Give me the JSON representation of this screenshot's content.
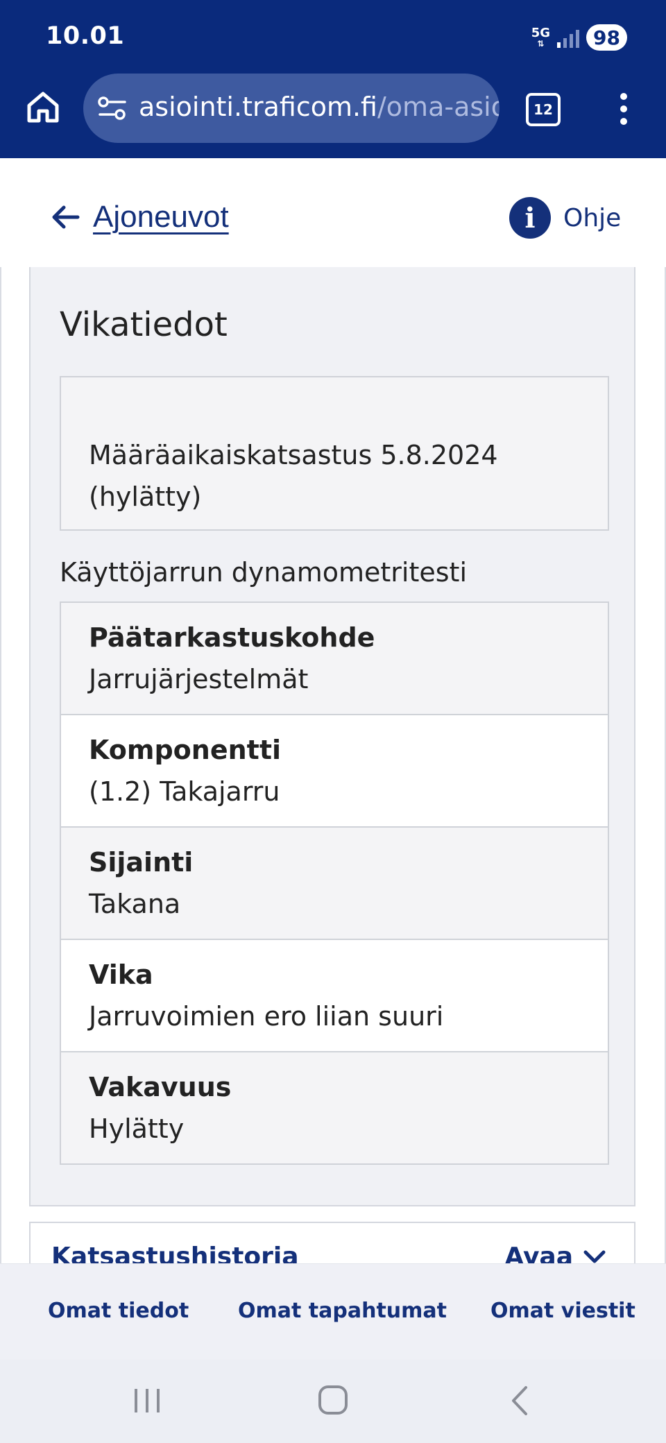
{
  "status_bar": {
    "time": "10.01",
    "network": "5G",
    "battery": "98"
  },
  "browser": {
    "url_host": "asiointi.traficom.fi",
    "url_path": "/oma-asio",
    "tab_count": "12",
    "icons": [
      "home-icon",
      "site-settings-icon",
      "tabs-icon",
      "more-vert-icon"
    ]
  },
  "header": {
    "back_label": "Ajoneuvot",
    "help_label": "Ohje",
    "info_icon_glyph": "i"
  },
  "section": {
    "title": "Vikatiedot",
    "inspection": "Määräaikaiskatsastus 5.8.2024 (hylätty)",
    "sub_heading": "Käyttöjarrun dynamometritesti",
    "rows": [
      {
        "label": "Päätarkastuskohde",
        "value": "Jarrujärjestelmät"
      },
      {
        "label": "Komponentti",
        "value": "(1.2) Takajarru"
      },
      {
        "label": "Sijainti",
        "value": "Takana"
      },
      {
        "label": "Vika",
        "value": "Jarruvoimien ero liian suuri"
      },
      {
        "label": "Vakavuus",
        "value": "Hylätty"
      }
    ]
  },
  "history": {
    "title": "Katsastushistoria",
    "toggle_label": "Avaa"
  },
  "bottom_nav": {
    "items": [
      "Omat tiedot",
      "Omat tapahtumat",
      "Omat viestit"
    ]
  },
  "colors": {
    "brand_dark": "#0a2a7c",
    "link": "#14307a",
    "panel_bg": "#f0f1f5"
  }
}
